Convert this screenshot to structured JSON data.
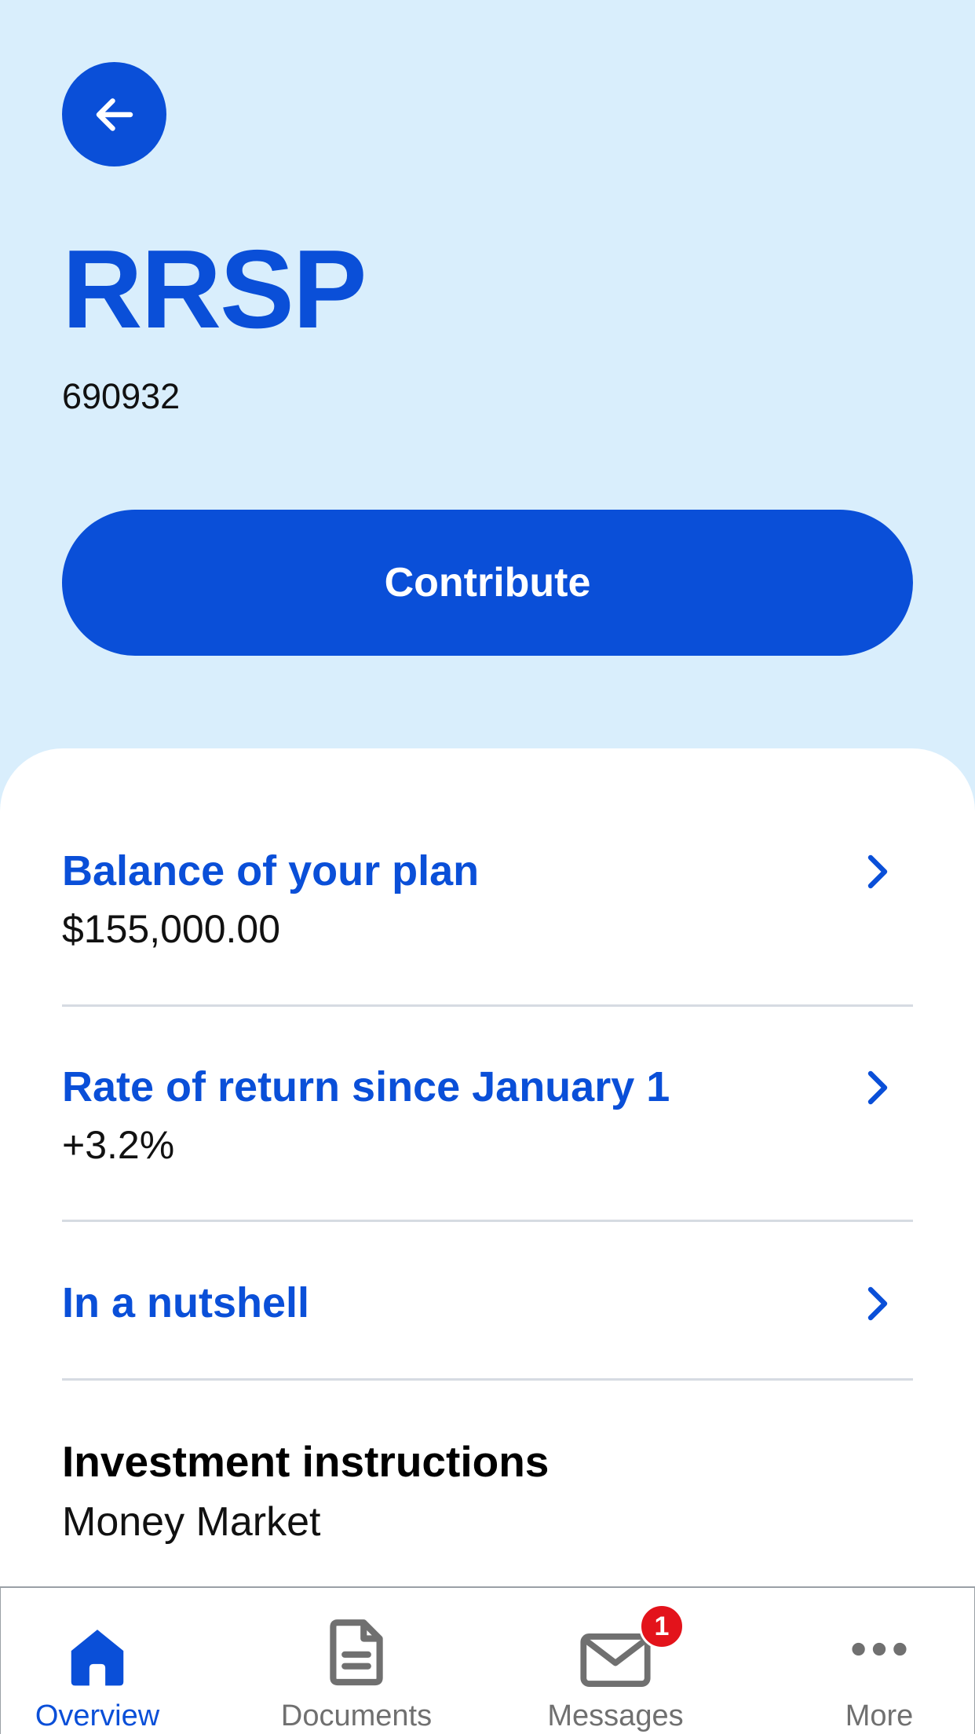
{
  "header": {
    "title": "RRSP",
    "account_number": "690932",
    "contribute_label": "Contribute"
  },
  "rows": [
    {
      "title": "Balance of your plan",
      "value": "$155,000.00"
    },
    {
      "title": "Rate of return since January 1",
      "value": "+3.2%"
    },
    {
      "title": "In a nutshell"
    }
  ],
  "investment": {
    "title": "Investment instructions",
    "value": "Money Market"
  },
  "tabs": [
    {
      "label": "Overview",
      "icon": "home-icon",
      "active": true
    },
    {
      "label": "Documents",
      "icon": "document-icon"
    },
    {
      "label": "Messages",
      "icon": "envelope-icon",
      "badge": "1"
    },
    {
      "label": "More",
      "icon": "more-icon"
    }
  ],
  "colors": {
    "header_bg": "#d9eefc",
    "accent": "#0a4fd8",
    "badge": "#e3131b",
    "inactive": "#707070"
  }
}
